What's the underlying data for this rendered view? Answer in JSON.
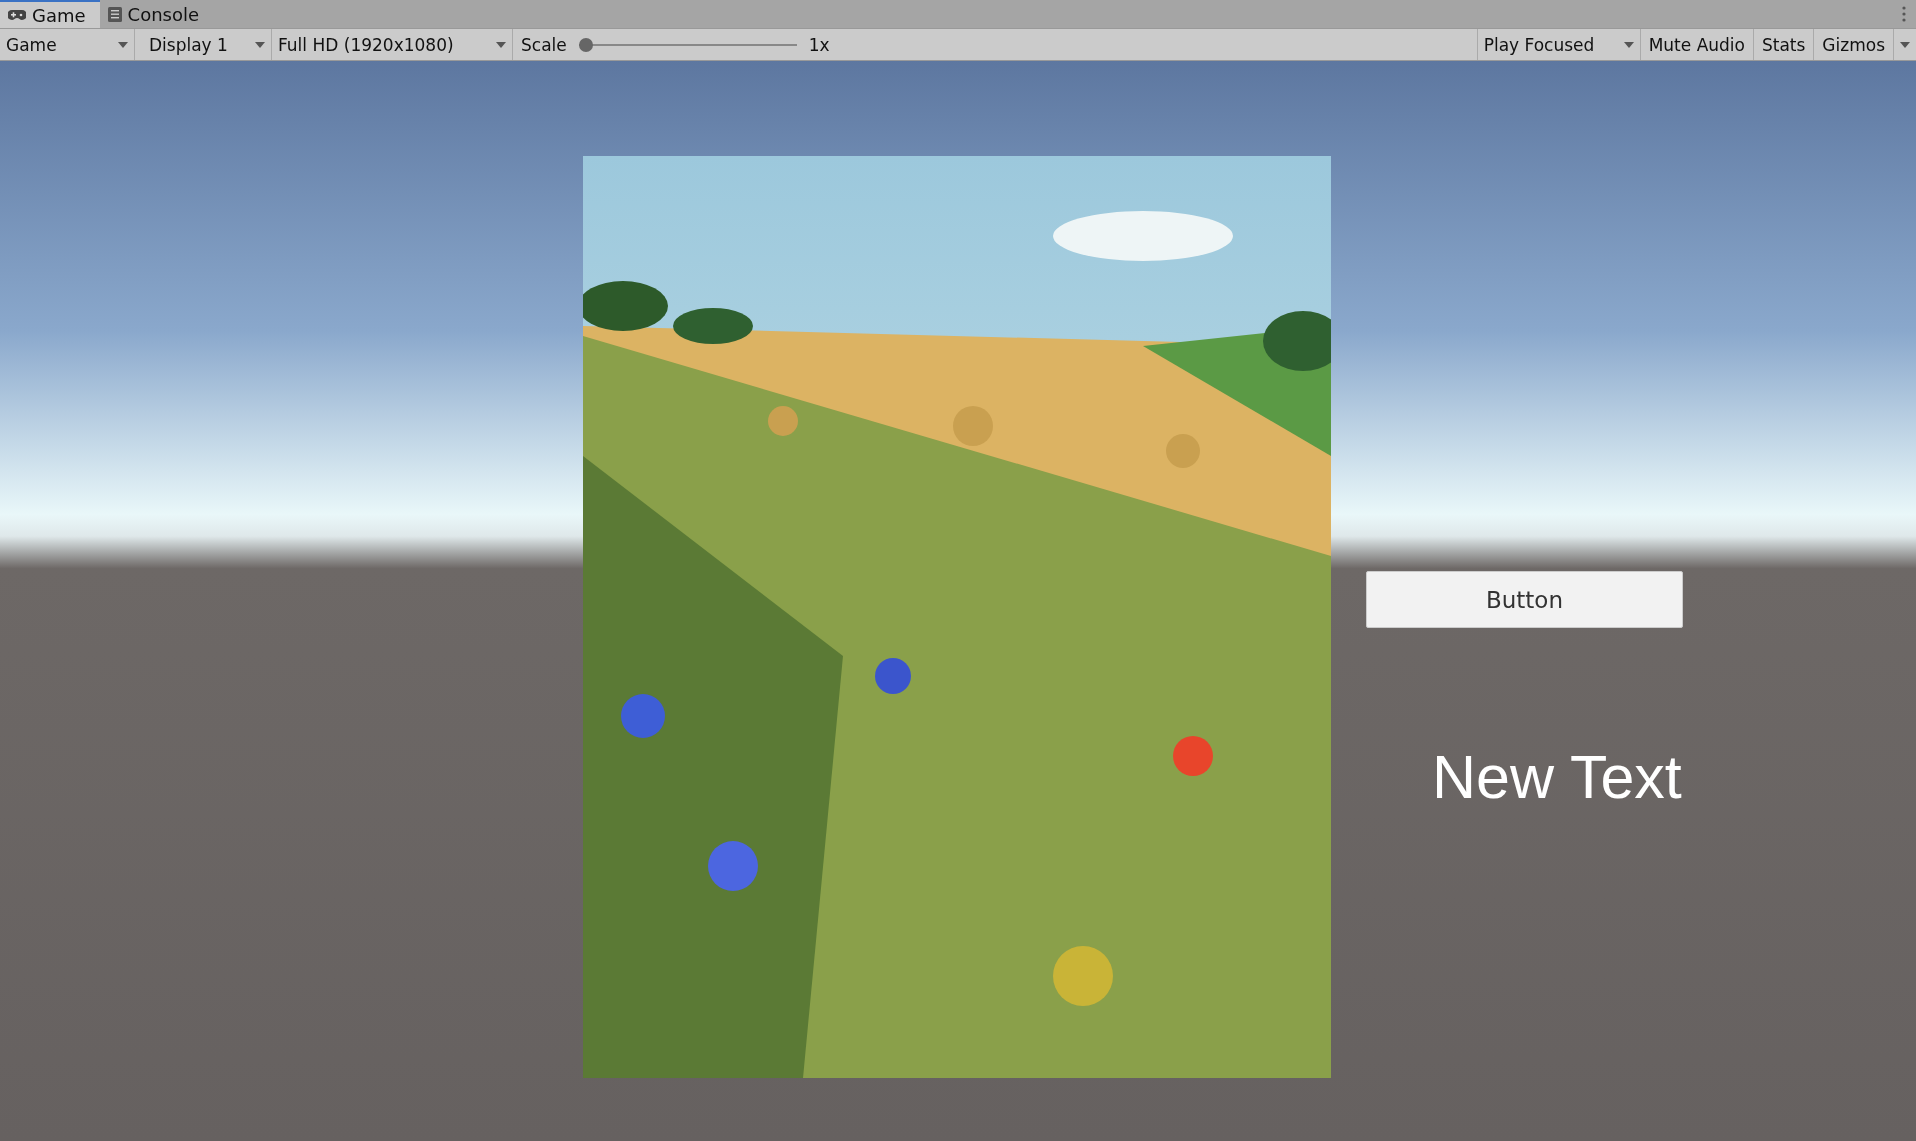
{
  "tabs": [
    {
      "label": "Game",
      "kind": "gamepad",
      "selected": true
    },
    {
      "label": "Console",
      "kind": "list",
      "selected": false
    }
  ],
  "toolbar": {
    "view_mode": "Game",
    "display": "Display 1",
    "resolution": "Full HD (1920x1080)",
    "scale": {
      "label": "Scale",
      "level": 0.0,
      "reading": "1x"
    },
    "play_mode": "Play Focused",
    "buttons": [
      "Mute Audio",
      "Stats",
      "Gizmos"
    ]
  },
  "game_view": {
    "button": "Button",
    "text": "New Text"
  }
}
